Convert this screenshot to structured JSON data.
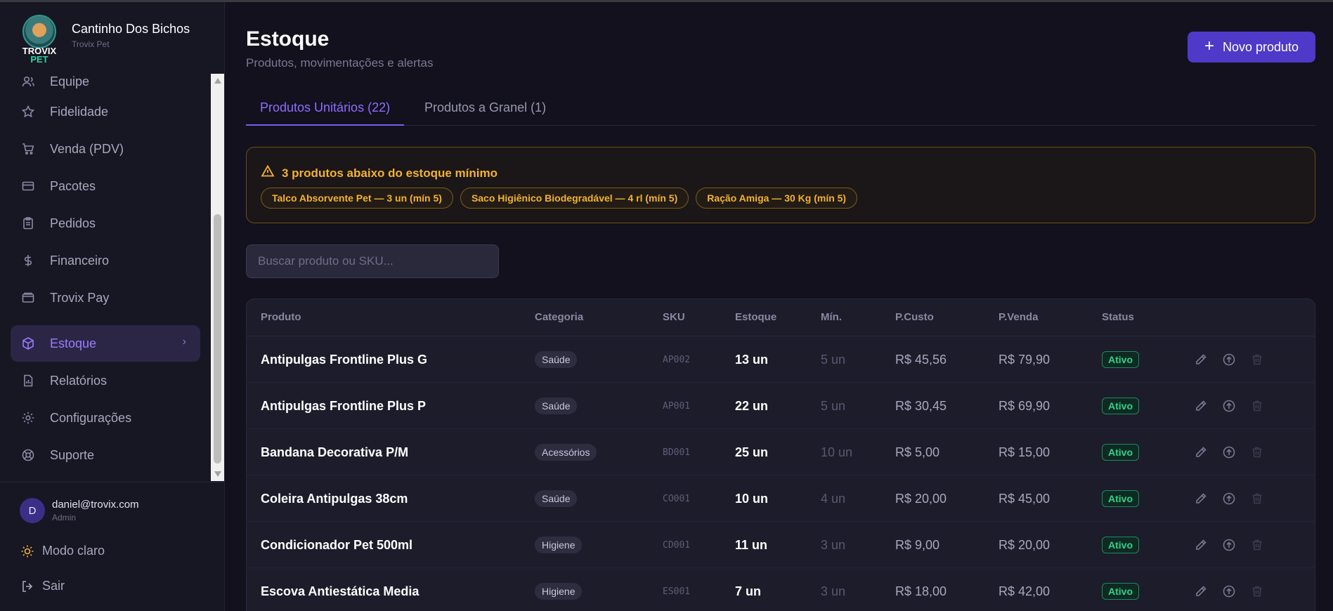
{
  "brand": {
    "logo_top": "TROVIX",
    "logo_bottom": "PET",
    "name": "Cantinho Dos Bichos",
    "sub": "Trovix Pet"
  },
  "sidebar": {
    "items": [
      {
        "label": "Equipe",
        "icon": "users-icon"
      },
      {
        "label": "Fidelidade",
        "icon": "star-icon"
      },
      {
        "label": "Venda (PDV)",
        "icon": "cart-icon"
      },
      {
        "label": "Pacotes",
        "icon": "card-icon"
      },
      {
        "label": "Pedidos",
        "icon": "clipboard-icon"
      },
      {
        "label": "Financeiro",
        "icon": "dollar-icon"
      },
      {
        "label": "Trovix Pay",
        "icon": "wallet-icon"
      },
      {
        "label": "Estoque",
        "icon": "box-icon",
        "active": true
      },
      {
        "label": "Relatórios",
        "icon": "report-icon"
      },
      {
        "label": "Configurações",
        "icon": "gear-icon"
      },
      {
        "label": "Suporte",
        "icon": "lifebuoy-icon"
      }
    ]
  },
  "user": {
    "initial": "D",
    "email": "daniel@trovix.com",
    "role": "Admin"
  },
  "footer": {
    "theme_label": "Modo claro",
    "logout_label": "Sair"
  },
  "page": {
    "title": "Estoque",
    "subtitle": "Produtos, movimentações e alertas",
    "new_button": "Novo produto"
  },
  "tabs": [
    {
      "label": "Produtos Unitários (22)",
      "active": true
    },
    {
      "label": "Produtos a Granel (1)",
      "active": false
    }
  ],
  "alert": {
    "title": "3 produtos abaixo do estoque mínimo",
    "chips": [
      "Talco Absorvente Pet — 3 un (mín 5)",
      "Saco Higiênico Biodegradável — 4 rl (mín 5)",
      "Ração Amiga — 30 Kg (mín 5)"
    ]
  },
  "search": {
    "placeholder": "Buscar produto ou SKU..."
  },
  "table": {
    "headers": [
      "Produto",
      "Categoria",
      "SKU",
      "Estoque",
      "Mín.",
      "P.Custo",
      "P.Venda",
      "Status"
    ],
    "rows": [
      [
        "Antipulgas Frontline Plus G",
        "Saúde",
        "AP002",
        "13 un",
        "5 un",
        "R$ 45,56",
        "R$ 79,90",
        "Ativo"
      ],
      [
        "Antipulgas Frontline Plus P",
        "Saúde",
        "AP001",
        "22 un",
        "5 un",
        "R$ 30,45",
        "R$ 69,90",
        "Ativo"
      ],
      [
        "Bandana Decorativa P/M",
        "Acessórios",
        "BD001",
        "25 un",
        "10 un",
        "R$ 5,00",
        "R$ 15,00",
        "Ativo"
      ],
      [
        "Coleira Antipulgas 38cm",
        "Saúde",
        "CO001",
        "10 un",
        "4 un",
        "R$ 20,00",
        "R$ 45,00",
        "Ativo"
      ],
      [
        "Condicionador Pet 500ml",
        "Higiene",
        "CD001",
        "11 un",
        "3 un",
        "R$ 9,00",
        "R$ 20,00",
        "Ativo"
      ],
      [
        "Escova Antiestática Media",
        "Higiene",
        "ES001",
        "7 un",
        "3 un",
        "R$ 18,00",
        "R$ 42,00",
        "Ativo"
      ]
    ]
  },
  "colors": {
    "accent": "#4f39c9",
    "active_tab": "#8e6dff",
    "warning": "#f3b233",
    "success": "#2fd38b"
  }
}
